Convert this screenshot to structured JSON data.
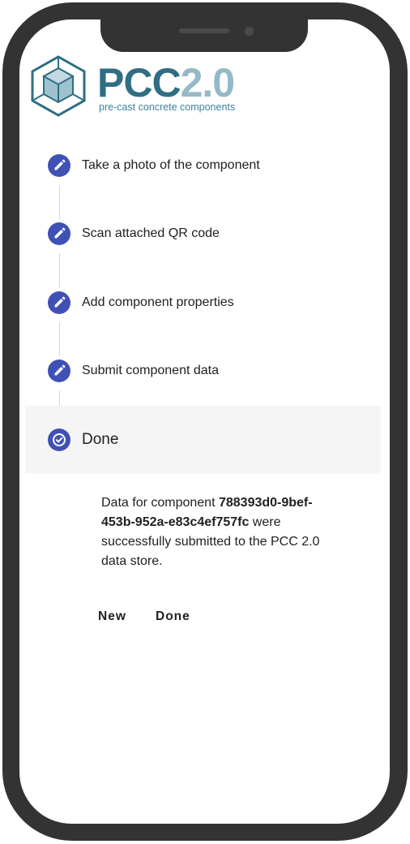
{
  "logo": {
    "name_main": "PCC",
    "name_version": "2.0",
    "tagline": "pre-cast concrete components",
    "icon": "cube-logo-icon"
  },
  "colors": {
    "accent": "#3f51b5",
    "brand_dark": "#2f6e84",
    "brand_light": "#95b9c7",
    "active_step_bg": "#f5f5f5",
    "phone_frame": "#333333"
  },
  "stepper": {
    "steps": [
      {
        "label": "Take a photo of the component",
        "icon": "edit-icon"
      },
      {
        "label": "Scan attached QR code",
        "icon": "edit-icon"
      },
      {
        "label": "Add component properties",
        "icon": "edit-icon"
      },
      {
        "label": "Submit component data",
        "icon": "edit-icon"
      },
      {
        "label": "Done",
        "icon": "check-icon",
        "active": true
      }
    ]
  },
  "done": {
    "message_prefix": "Data for component ",
    "component_id": "788393d0-9bef-453b-952a-e83c4ef757fc",
    "message_suffix": " were successfully submitted to the PCC 2.0 data store.",
    "new_button": "New",
    "done_button": "Done"
  }
}
